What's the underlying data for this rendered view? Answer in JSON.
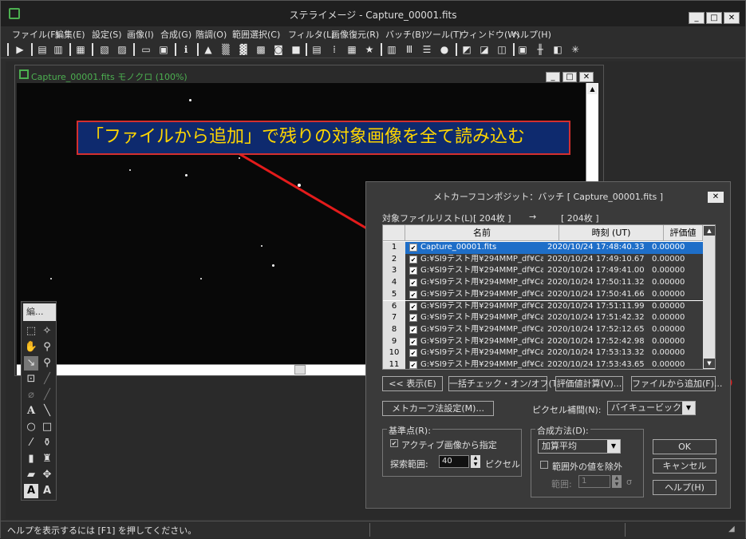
{
  "window": {
    "title": "ステライメージ - Capture_00001.fits"
  },
  "menu": [
    "ファイル(F)",
    "編集(E)",
    "設定(S)",
    "画像(I)",
    "合成(G)",
    "階調(O)",
    "範囲選択(C)",
    "フィルタ(L)",
    "画像復元(R)",
    "バッチ(B)",
    "ツール(T)",
    "ウィンドウ(W)",
    "ヘルプ(H)"
  ],
  "image_window": {
    "title": "Capture_00001.fits モノクロ (100%)"
  },
  "annotation": {
    "text": "「ファイルから追加」で残りの対象画像を全て読み込む",
    "color": "#d32f2f"
  },
  "palette": {
    "title": "編..."
  },
  "dialog": {
    "title": "メトカーフコンポジット：バッチ [ Capture_00001.fits ]",
    "file_list_label": "対象ファイルリスト(L):",
    "count_before": "[ 204枚 ]",
    "arrow": "→",
    "count_after": "[ 204枚 ]",
    "columns": [
      "名前",
      "時刻 (UT)",
      "評価値"
    ],
    "rows": [
      {
        "n": "1",
        "name": "Capture_00001.fits",
        "time": "2020/10/24  17:48:40.33",
        "score": "0.00000"
      },
      {
        "n": "2",
        "name": "G:¥SI9テスト用¥294MMP_df¥Ca...",
        "time": "2020/10/24  17:49:10.67",
        "score": "0.00000"
      },
      {
        "n": "3",
        "name": "G:¥SI9テスト用¥294MMP_df¥Ca...",
        "time": "2020/10/24  17:49:41.00",
        "score": "0.00000"
      },
      {
        "n": "4",
        "name": "G:¥SI9テスト用¥294MMP_df¥Ca...",
        "time": "2020/10/24  17:50:11.32",
        "score": "0.00000"
      },
      {
        "n": "5",
        "name": "G:¥SI9テスト用¥294MMP_df¥Ca...",
        "time": "2020/10/24  17:50:41.66",
        "score": "0.00000"
      },
      {
        "n": "6",
        "name": "G:¥SI9テスト用¥294MMP_df¥Ca...",
        "time": "2020/10/24  17:51:11.99",
        "score": "0.00000"
      },
      {
        "n": "7",
        "name": "G:¥SI9テスト用¥294MMP_df¥Ca...",
        "time": "2020/10/24  17:51:42.32",
        "score": "0.00000"
      },
      {
        "n": "8",
        "name": "G:¥SI9テスト用¥294MMP_df¥Ca...",
        "time": "2020/10/24  17:52:12.65",
        "score": "0.00000"
      },
      {
        "n": "9",
        "name": "G:¥SI9テスト用¥294MMP_df¥Ca...",
        "time": "2020/10/24  17:52:42.98",
        "score": "0.00000"
      },
      {
        "n": "10",
        "name": "G:¥SI9テスト用¥294MMP_df¥Ca...",
        "time": "2020/10/24  17:53:13.32",
        "score": "0.00000"
      },
      {
        "n": "11",
        "name": "G:¥SI9テスト用¥294MMP_df¥Ca...",
        "time": "2020/10/24  17:53:43.65",
        "score": "0.00000"
      }
    ],
    "buttons": {
      "show": "<< 表示(E)",
      "toggle_check": "一括チェック・オン/オフ(T)",
      "evaluate": "評価値計算(V)...",
      "add_from_file": "ファイルから追加(F)...",
      "metcalf_settings": "メトカーフ法設定(M)...",
      "ok": "OK",
      "cancel": "キャンセル",
      "help": "ヘルプ(H)"
    },
    "pixel_interp_label": "ピクセル補間(N):",
    "pixel_interp_value": "バイキュービック",
    "ref_group": {
      "title": "基準点(R):",
      "active_label": "アクティブ画像から指定",
      "search_label": "探索範囲:",
      "search_value": "40",
      "search_unit": "ピクセル"
    },
    "method_group": {
      "title": "合成方法(D):",
      "method_value": "加算平均",
      "exclude_label": "範囲外の値を除外",
      "range_label": "範囲:",
      "range_value": "1",
      "sigma": "σ"
    }
  },
  "status": {
    "text": "ヘルプを表示するには [F1] を押してください。"
  }
}
